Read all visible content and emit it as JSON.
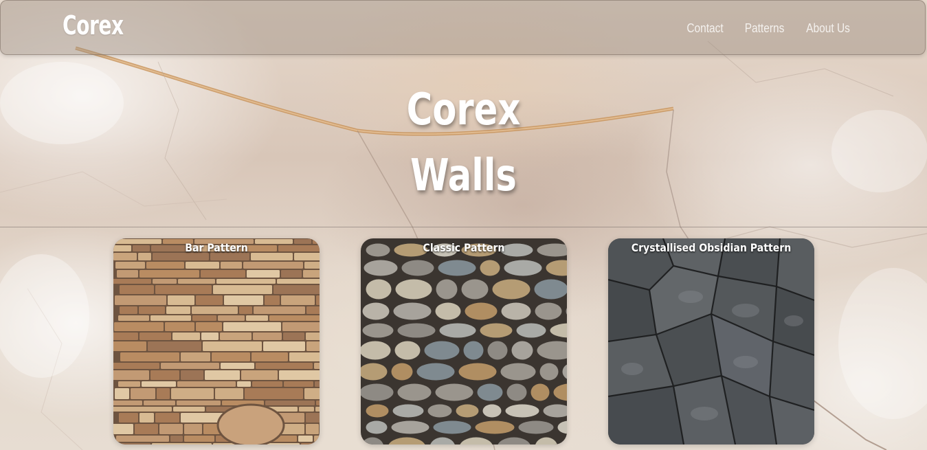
{
  "brand": "Corex",
  "nav": {
    "contact": "Contact",
    "patterns": "Patterns",
    "about": "About Us"
  },
  "hero": {
    "line1": "Corex",
    "line2": "Walls"
  },
  "cards": [
    {
      "title": "Bar Pattern"
    },
    {
      "title": "Classic Pattern"
    },
    {
      "title": "Crystallised Obsidian Pattern"
    }
  ],
  "colors": {
    "text": "#ffffff",
    "navbar_tint": "#968779",
    "background": "#d9cdc2"
  }
}
